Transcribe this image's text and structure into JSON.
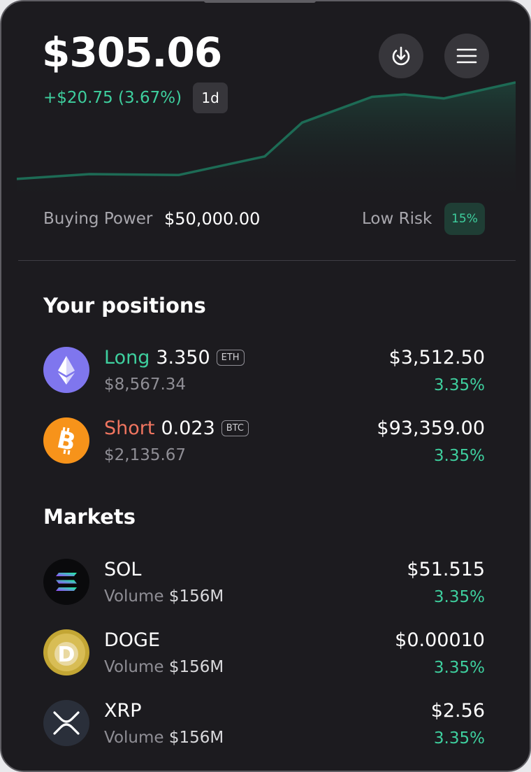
{
  "header": {
    "balance": "$305.06",
    "change": "+$20.75 (3.67%)",
    "period": "1d",
    "download_icon": "download-icon",
    "menu_icon": "menu-icon"
  },
  "chart_data": {
    "type": "area",
    "values": [
      230,
      236,
      235,
      258,
      300,
      332,
      335,
      330,
      350
    ],
    "title": "",
    "xlabel": "",
    "ylabel": "",
    "color": "#1d6b55"
  },
  "stats": {
    "buying_power_label": "Buying Power",
    "buying_power_value": "$50,000.00",
    "risk_label": "Low Risk",
    "risk_value": "15%"
  },
  "positions": {
    "title": "Your positions",
    "items": [
      {
        "side": "Long",
        "amount": "3.350",
        "symbol": "ETH",
        "value": "$8,567.34",
        "price": "$3,512.50",
        "change": "3.35%",
        "icon": "ethereum-icon"
      },
      {
        "side": "Short",
        "amount": "0.023",
        "symbol": "BTC",
        "value": "$2,135.67",
        "price": "$93,359.00",
        "change": "3.35%",
        "icon": "bitcoin-icon"
      }
    ]
  },
  "markets": {
    "title": "Markets",
    "volume_label": "Volume",
    "items": [
      {
        "name": "SOL",
        "volume": "$156M",
        "price": "$51.515",
        "change": "3.35%",
        "icon": "solana-icon"
      },
      {
        "name": "DOGE",
        "volume": "$156M",
        "price": "$0.00010",
        "change": "3.35%",
        "icon": "dogecoin-icon"
      },
      {
        "name": "XRP",
        "volume": "$156M",
        "price": "$2.56",
        "change": "3.35%",
        "icon": "xrp-icon"
      }
    ]
  },
  "colors": {
    "background": "#1c1b1f",
    "positive": "#3ecf9e",
    "negative": "#f07560"
  }
}
